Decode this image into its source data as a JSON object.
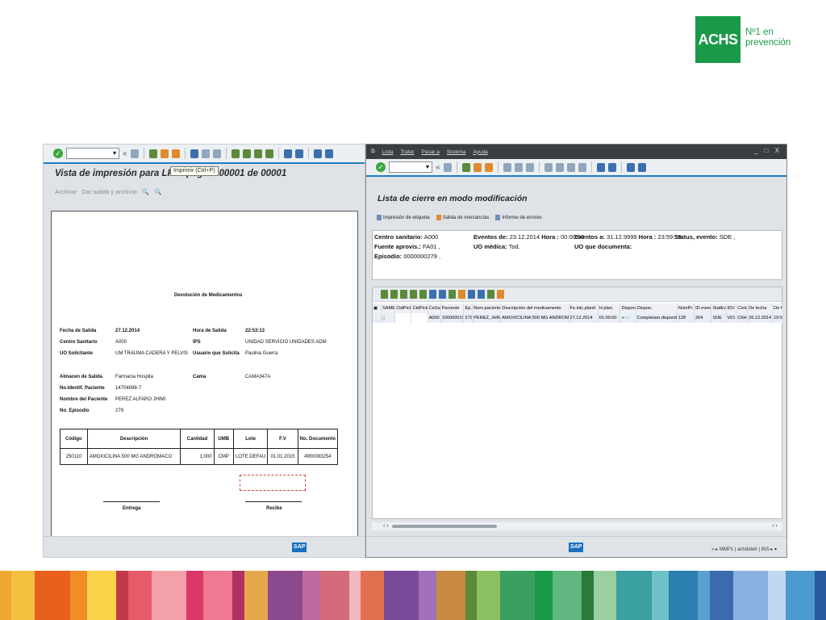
{
  "logo": {
    "brand": "ACHS",
    "tagline_1": "Nº1 en",
    "tagline_2": "prevención"
  },
  "left_window": {
    "title": "Vista de impresión para LP01 página 00001 de 00001",
    "tooltip": "Imprimir   (Ctrl+P)",
    "appbar": {
      "archive": "Archivar",
      "print_archive": "Dar salida y archivar"
    },
    "doc": {
      "heading": "Devolución de Medicamentos",
      "fecha_label": "Fecha de Salida",
      "fecha_value": "27.12.2014",
      "hora_label": "Hora de Salida",
      "hora_value": "22:53:13",
      "centro_label": "Centro Sanitario",
      "centro_value": "A000",
      "ips_label": "IPS",
      "ips_value": "UNIDAD  SERVICIO UNIDADES  ADM",
      "uo_label": "UO Solicitante",
      "uo_value": "UM TRAUMA CADERA Y PELVIS",
      "usuario_label": "Usuario que Solicita",
      "usuario_value": "Paulina Guerra",
      "almacen_label": "Almacen de Salida",
      "almacen_value": "Farmacia Hospita",
      "cama_label": "Cama",
      "cama_value": "CAMA347A",
      "identif_label": "No.Identif. Paciente",
      "identif_value": "14704698-7",
      "nombre_label": "Nombre del Paciente",
      "nombre_value": "PEREZ  ALFARO  JHIMI",
      "episodio_label": "No. Episodio",
      "episodio_value": "279",
      "table": {
        "headers": [
          "Código",
          "Descripción",
          "Cantidad",
          "UMB",
          "Lote",
          "F.V",
          "No. Documento"
        ],
        "row": [
          "250110",
          "AMOXICILINA  500  MG  ANDROMACO",
          "1,000",
          "CMP",
          "LOTE  DEFAU",
          "01.01.2015",
          "4900083254"
        ]
      },
      "entrega": "Entrega",
      "recibe": "Recibe"
    }
  },
  "right_window": {
    "menu": [
      "Lista",
      "Tratar",
      "Pasar a",
      "Sistema",
      "Ayuda"
    ],
    "title": "Lista de cierre en modo modificación",
    "actions": [
      "Impresión de etiqueta",
      "Salida de mercancías",
      "Informe de errores"
    ],
    "header": {
      "centro_label": "Centro sanitario:",
      "centro_value": "A000",
      "eventos_de_label": "Eventos de:",
      "eventos_de_value": "23.12.2014",
      "hora1_label": "Hora :",
      "hora1_value": "00:00:00",
      "eventos_a_label": "Eventos a:",
      "eventos_a_value": "31.12.9999",
      "hora2_label": "Hora :",
      "hora2_value": "23:59:59",
      "status_label": "Status, evento:",
      "status_value": "SDE ,",
      "fuente_label": "Fuente aprovis.:",
      "fuente_value": "FA01 ,",
      "uo_medica_label": "UO médica:",
      "uo_medica_value": "Tod.",
      "uo_doc_label": "UO que documenta:",
      "episodio_label": "Episodio:",
      "episodio_value": "0000000279 ,"
    },
    "grid": {
      "columns": [
        "SAMER",
        "CtdPickO",
        "CtdPickE",
        "CeSa",
        "Paciente",
        "Ep.",
        "Nom.paciente",
        "Descripción del medicamento",
        "Fe.inic.planif.",
        "H.plan.",
        "Dispon.",
        "Dispon.",
        "NúmPr.",
        "ID even.",
        "StatEv",
        "IDV",
        "Ciclo",
        "De fecha",
        "De ho"
      ],
      "row": [
        "",
        "",
        "",
        "A000",
        "1000000195",
        "279",
        "PEREZ, JHIMI",
        "AMOXICILINA 500 MG ANDROMACO",
        "27.12.2014",
        "01:00:00",
        "",
        "Completam.disponible",
        "128",
        "264",
        "SDE",
        "V01",
        "C6H",
        "26.12.2014",
        "19:00"
      ]
    },
    "status": "MMP1  |  achdoteh  |  INS"
  },
  "colors": {
    "brand_green": "#1a9a48",
    "sap_blue": "#1c7ec4"
  }
}
